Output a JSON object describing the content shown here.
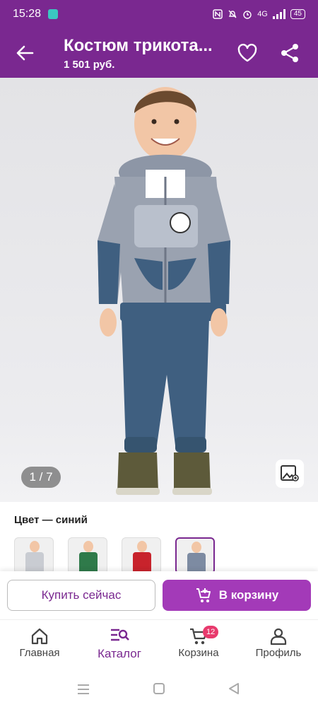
{
  "status": {
    "time": "15:28",
    "network": "4G",
    "battery": "45"
  },
  "header": {
    "title": "Костюм трикота...",
    "price": "1 501 руб."
  },
  "gallery": {
    "counter": "1 / 7"
  },
  "color": {
    "label": "Цвет — синий",
    "swatch_colors": [
      "#c9ccd2",
      "#2f7a4a",
      "#c8232c",
      "#7d8ba2"
    ]
  },
  "actions": {
    "buy_now": "Купить сейчас",
    "add_to_cart": "В корзину"
  },
  "nav": {
    "items": [
      {
        "label": "Главная",
        "icon": "home-icon"
      },
      {
        "label": "Каталог",
        "icon": "catalog-search-icon"
      },
      {
        "label": "Корзина",
        "icon": "cart-icon",
        "badge": "12"
      },
      {
        "label": "Профиль",
        "icon": "profile-icon"
      }
    ]
  },
  "colors": {
    "brand": "#7a2890",
    "accent": "#a33ab8",
    "badge": "#e83a6d"
  }
}
